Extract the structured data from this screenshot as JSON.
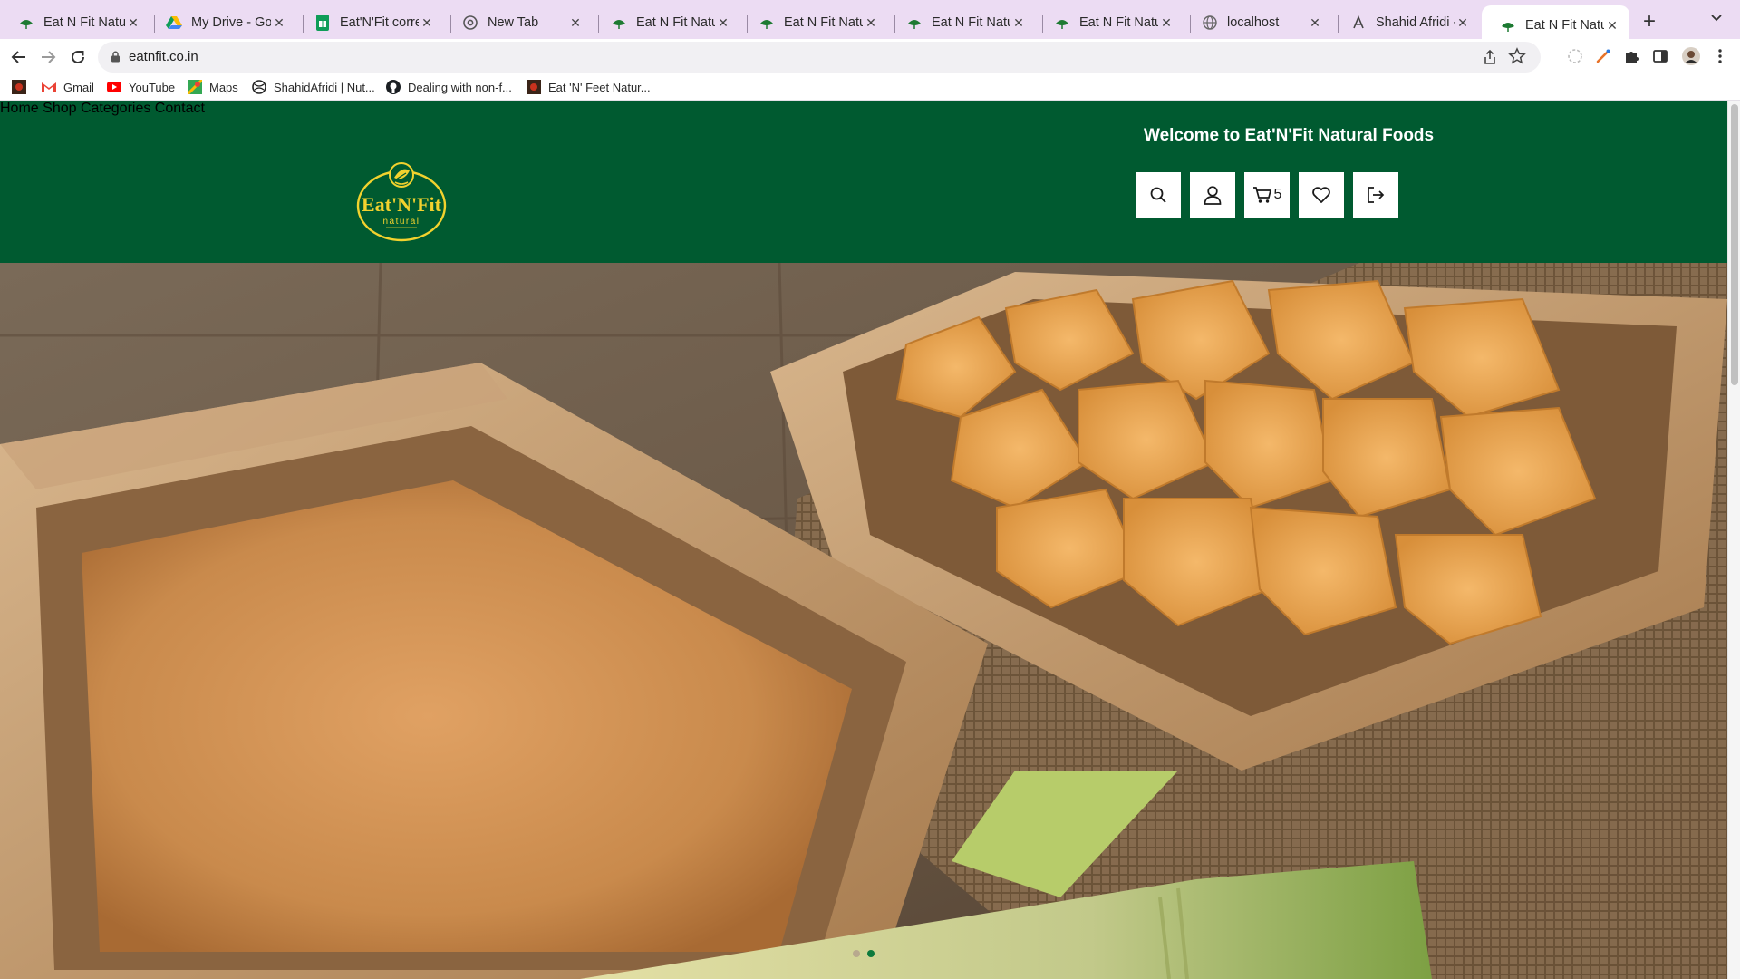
{
  "browser": {
    "tabs": [
      {
        "title": "Eat N Fit Naturals",
        "favicon": "leaf-icon"
      },
      {
        "title": "My Drive - Google Drive",
        "favicon": "google-drive-icon"
      },
      {
        "title": "Eat'N'Fit correction",
        "favicon": "sheets-icon"
      },
      {
        "title": "New Tab",
        "favicon": "chrome-icon"
      },
      {
        "title": "Eat N Fit Naturals",
        "favicon": "leaf-icon"
      },
      {
        "title": "Eat N Fit Naturals",
        "favicon": "leaf-icon"
      },
      {
        "title": "Eat N Fit Naturals",
        "favicon": "leaf-icon"
      },
      {
        "title": "Eat N Fit Naturals",
        "favicon": "leaf-icon"
      },
      {
        "title": "localhost",
        "favicon": "globe-icon"
      },
      {
        "title": "Shahid Afridi - Portfolio",
        "favicon": "signature-icon"
      },
      {
        "title": "Eat N Fit Naturals",
        "favicon": "leaf-icon",
        "active": true
      }
    ],
    "url": "eatnfit.co.in",
    "bookmarks": [
      {
        "label": "",
        "icon": "eatnfit-bookmark-icon"
      },
      {
        "label": "Gmail",
        "icon": "gmail-icon"
      },
      {
        "label": "YouTube",
        "icon": "youtube-icon"
      },
      {
        "label": "Maps",
        "icon": "maps-icon"
      },
      {
        "label": "ShahidAfridi | Nut...",
        "icon": "globe-dark-icon"
      },
      {
        "label": "Dealing with non-f...",
        "icon": "github-icon"
      },
      {
        "label": "Eat 'N' Feet Natur...",
        "icon": "eatnfit-bookmark-icon"
      }
    ]
  },
  "site": {
    "welcome": "Welcome to Eat'N'Fit Natural Foods",
    "logo": {
      "brand": "Eat'N'Fit",
      "sub": "natural"
    },
    "nav": [
      "Home",
      "Shop",
      "Categories",
      "Contact"
    ],
    "cart_count": "5",
    "colors": {
      "header": "#005a30",
      "logo": "#f2d22e",
      "dot_active": "#0d7a3d"
    },
    "header_icons": [
      "search-icon",
      "user-icon",
      "cart-icon",
      "heart-icon",
      "logout-icon"
    ],
    "hero": {
      "slides": 2,
      "active_slide": 2
    }
  }
}
